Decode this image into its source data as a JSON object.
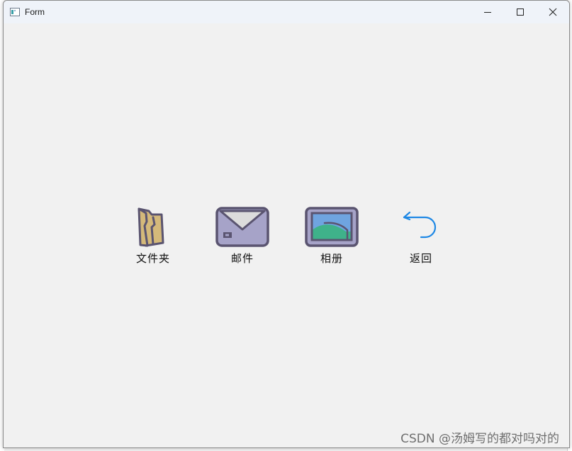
{
  "window": {
    "title": "Form",
    "icon": "form-app-icon",
    "controls": [
      "minimize-icon",
      "maximize-icon",
      "close-icon"
    ]
  },
  "tiles": [
    {
      "label": "文件夹",
      "icon": "folder-icon"
    },
    {
      "label": "邮件",
      "icon": "mail-icon"
    },
    {
      "label": "相册",
      "icon": "photo-album-icon"
    },
    {
      "label": "返回",
      "icon": "back-arrow-icon"
    }
  ],
  "watermark": "CSDN @汤姆写的都对吗对的",
  "colors": {
    "titlebar": "#eff3f9",
    "client": "#f1f1f1",
    "folder": "#d4b97a",
    "icon_outline": "#5a5470",
    "mail_body": "#a6a3c8",
    "photo_sky": "#6fa4e0",
    "photo_hill": "#3fb28a",
    "back_arrow": "#1e88e5"
  }
}
